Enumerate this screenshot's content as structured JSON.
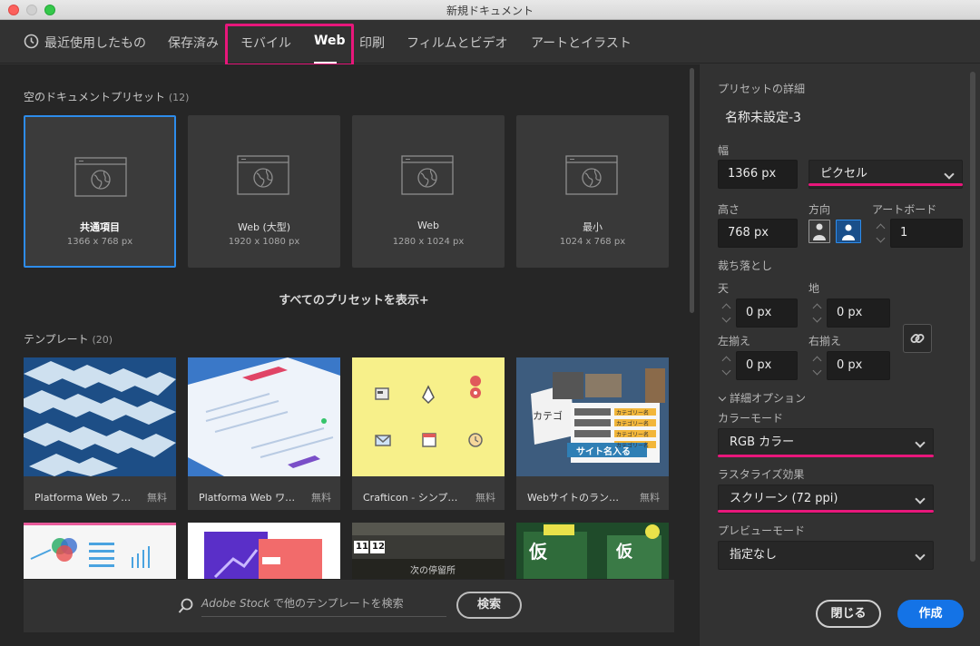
{
  "window": {
    "title": "新規ドキュメント"
  },
  "tabs": [
    {
      "label": "最近使用したもの"
    },
    {
      "label": "保存済み"
    },
    {
      "label": "モバイル"
    },
    {
      "label": "Web"
    },
    {
      "label": "印刷"
    },
    {
      "label": "フィルムとビデオ"
    },
    {
      "label": "アートとイラスト"
    }
  ],
  "active_tab": "Web",
  "presets": {
    "title": "空のドキュメントプリセット",
    "count": "(12)",
    "items": [
      {
        "name": "共通項目",
        "size": "1366 x 768 px"
      },
      {
        "name": "Web (大型)",
        "size": "1920 x 1080 px"
      },
      {
        "name": "Web",
        "size": "1280 x 1024 px"
      },
      {
        "name": "最小",
        "size": "1024 x 768 px"
      }
    ],
    "show_all": "すべてのプリセットを表示+"
  },
  "templates": {
    "title": "テンプレート",
    "count": "(20)",
    "items": [
      {
        "name": "Platforma Web フロ…",
        "price": "無料"
      },
      {
        "name": "Platforma Web ワイ…",
        "price": "無料"
      },
      {
        "name": "Crafticon - シンプル…",
        "price": "無料"
      },
      {
        "name": "Webサイトのラン…",
        "price": "無料"
      }
    ],
    "thumb_texts": {
      "card4_heading": "カテゴ",
      "card4_name": "サイト名入る",
      "card4_rows": [
        "カテゴリー名",
        "カテゴリー名",
        "カテゴリー名",
        "カテゴリー名"
      ],
      "card7_digits": [
        "11",
        "12"
      ],
      "card7_text": "次の停留所",
      "card8_text": "仮",
      "card8_text2": "仮"
    }
  },
  "search": {
    "placeholder_brand": "Adobe Stock",
    "placeholder_rest": " で他のテンプレートを検索",
    "button": "検索"
  },
  "details": {
    "title": "プリセットの詳細",
    "doc_name": "名称未設定-3",
    "width_label": "幅",
    "width": "1366 px",
    "unit": "ピクセル",
    "height_label": "高さ",
    "height": "768 px",
    "orientation_label": "方向",
    "artboard_label": "アートボード",
    "artboard_count": "1",
    "bleed_label": "裁ち落とし",
    "top_label": "天",
    "top": "0 px",
    "bottom_label": "地",
    "bottom": "0 px",
    "left_label": "左揃え",
    "left": "0 px",
    "right_label": "右揃え",
    "right": "0 px",
    "advanced": "詳細オプション",
    "color_mode_label": "カラーモード",
    "color_mode": "RGB カラー",
    "raster_label": "ラスタライズ効果",
    "raster": "スクリーン (72 ppi)",
    "preview_label": "プレビューモード",
    "preview": "指定なし"
  },
  "buttons": {
    "close": "閉じる",
    "create": "作成"
  },
  "colors": {
    "accent_blue": "#1473e6",
    "highlight_pink": "#e8177b",
    "selection_blue": "#2d8ceb"
  }
}
